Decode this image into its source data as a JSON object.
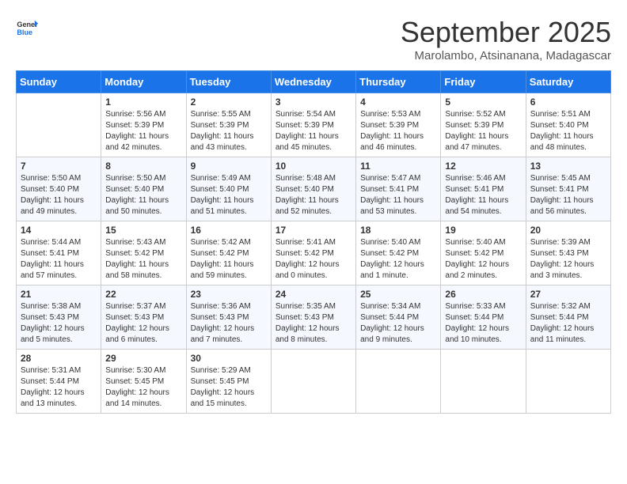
{
  "logo": {
    "line1": "General",
    "line2": "Blue"
  },
  "title": "September 2025",
  "location": "Marolambo, Atsinanana, Madagascar",
  "days_of_week": [
    "Sunday",
    "Monday",
    "Tuesday",
    "Wednesday",
    "Thursday",
    "Friday",
    "Saturday"
  ],
  "weeks": [
    [
      {
        "day": "",
        "sunrise": "",
        "sunset": "",
        "daylight": ""
      },
      {
        "day": "1",
        "sunrise": "Sunrise: 5:56 AM",
        "sunset": "Sunset: 5:39 PM",
        "daylight": "Daylight: 11 hours and 42 minutes."
      },
      {
        "day": "2",
        "sunrise": "Sunrise: 5:55 AM",
        "sunset": "Sunset: 5:39 PM",
        "daylight": "Daylight: 11 hours and 43 minutes."
      },
      {
        "day": "3",
        "sunrise": "Sunrise: 5:54 AM",
        "sunset": "Sunset: 5:39 PM",
        "daylight": "Daylight: 11 hours and 45 minutes."
      },
      {
        "day": "4",
        "sunrise": "Sunrise: 5:53 AM",
        "sunset": "Sunset: 5:39 PM",
        "daylight": "Daylight: 11 hours and 46 minutes."
      },
      {
        "day": "5",
        "sunrise": "Sunrise: 5:52 AM",
        "sunset": "Sunset: 5:39 PM",
        "daylight": "Daylight: 11 hours and 47 minutes."
      },
      {
        "day": "6",
        "sunrise": "Sunrise: 5:51 AM",
        "sunset": "Sunset: 5:40 PM",
        "daylight": "Daylight: 11 hours and 48 minutes."
      }
    ],
    [
      {
        "day": "7",
        "sunrise": "Sunrise: 5:50 AM",
        "sunset": "Sunset: 5:40 PM",
        "daylight": "Daylight: 11 hours and 49 minutes."
      },
      {
        "day": "8",
        "sunrise": "Sunrise: 5:50 AM",
        "sunset": "Sunset: 5:40 PM",
        "daylight": "Daylight: 11 hours and 50 minutes."
      },
      {
        "day": "9",
        "sunrise": "Sunrise: 5:49 AM",
        "sunset": "Sunset: 5:40 PM",
        "daylight": "Daylight: 11 hours and 51 minutes."
      },
      {
        "day": "10",
        "sunrise": "Sunrise: 5:48 AM",
        "sunset": "Sunset: 5:40 PM",
        "daylight": "Daylight: 11 hours and 52 minutes."
      },
      {
        "day": "11",
        "sunrise": "Sunrise: 5:47 AM",
        "sunset": "Sunset: 5:41 PM",
        "daylight": "Daylight: 11 hours and 53 minutes."
      },
      {
        "day": "12",
        "sunrise": "Sunrise: 5:46 AM",
        "sunset": "Sunset: 5:41 PM",
        "daylight": "Daylight: 11 hours and 54 minutes."
      },
      {
        "day": "13",
        "sunrise": "Sunrise: 5:45 AM",
        "sunset": "Sunset: 5:41 PM",
        "daylight": "Daylight: 11 hours and 56 minutes."
      }
    ],
    [
      {
        "day": "14",
        "sunrise": "Sunrise: 5:44 AM",
        "sunset": "Sunset: 5:41 PM",
        "daylight": "Daylight: 11 hours and 57 minutes."
      },
      {
        "day": "15",
        "sunrise": "Sunrise: 5:43 AM",
        "sunset": "Sunset: 5:42 PM",
        "daylight": "Daylight: 11 hours and 58 minutes."
      },
      {
        "day": "16",
        "sunrise": "Sunrise: 5:42 AM",
        "sunset": "Sunset: 5:42 PM",
        "daylight": "Daylight: 11 hours and 59 minutes."
      },
      {
        "day": "17",
        "sunrise": "Sunrise: 5:41 AM",
        "sunset": "Sunset: 5:42 PM",
        "daylight": "Daylight: 12 hours and 0 minutes."
      },
      {
        "day": "18",
        "sunrise": "Sunrise: 5:40 AM",
        "sunset": "Sunset: 5:42 PM",
        "daylight": "Daylight: 12 hours and 1 minute."
      },
      {
        "day": "19",
        "sunrise": "Sunrise: 5:40 AM",
        "sunset": "Sunset: 5:42 PM",
        "daylight": "Daylight: 12 hours and 2 minutes."
      },
      {
        "day": "20",
        "sunrise": "Sunrise: 5:39 AM",
        "sunset": "Sunset: 5:43 PM",
        "daylight": "Daylight: 12 hours and 3 minutes."
      }
    ],
    [
      {
        "day": "21",
        "sunrise": "Sunrise: 5:38 AM",
        "sunset": "Sunset: 5:43 PM",
        "daylight": "Daylight: 12 hours and 5 minutes."
      },
      {
        "day": "22",
        "sunrise": "Sunrise: 5:37 AM",
        "sunset": "Sunset: 5:43 PM",
        "daylight": "Daylight: 12 hours and 6 minutes."
      },
      {
        "day": "23",
        "sunrise": "Sunrise: 5:36 AM",
        "sunset": "Sunset: 5:43 PM",
        "daylight": "Daylight: 12 hours and 7 minutes."
      },
      {
        "day": "24",
        "sunrise": "Sunrise: 5:35 AM",
        "sunset": "Sunset: 5:43 PM",
        "daylight": "Daylight: 12 hours and 8 minutes."
      },
      {
        "day": "25",
        "sunrise": "Sunrise: 5:34 AM",
        "sunset": "Sunset: 5:44 PM",
        "daylight": "Daylight: 12 hours and 9 minutes."
      },
      {
        "day": "26",
        "sunrise": "Sunrise: 5:33 AM",
        "sunset": "Sunset: 5:44 PM",
        "daylight": "Daylight: 12 hours and 10 minutes."
      },
      {
        "day": "27",
        "sunrise": "Sunrise: 5:32 AM",
        "sunset": "Sunset: 5:44 PM",
        "daylight": "Daylight: 12 hours and 11 minutes."
      }
    ],
    [
      {
        "day": "28",
        "sunrise": "Sunrise: 5:31 AM",
        "sunset": "Sunset: 5:44 PM",
        "daylight": "Daylight: 12 hours and 13 minutes."
      },
      {
        "day": "29",
        "sunrise": "Sunrise: 5:30 AM",
        "sunset": "Sunset: 5:45 PM",
        "daylight": "Daylight: 12 hours and 14 minutes."
      },
      {
        "day": "30",
        "sunrise": "Sunrise: 5:29 AM",
        "sunset": "Sunset: 5:45 PM",
        "daylight": "Daylight: 12 hours and 15 minutes."
      },
      {
        "day": "",
        "sunrise": "",
        "sunset": "",
        "daylight": ""
      },
      {
        "day": "",
        "sunrise": "",
        "sunset": "",
        "daylight": ""
      },
      {
        "day": "",
        "sunrise": "",
        "sunset": "",
        "daylight": ""
      },
      {
        "day": "",
        "sunrise": "",
        "sunset": "",
        "daylight": ""
      }
    ]
  ]
}
